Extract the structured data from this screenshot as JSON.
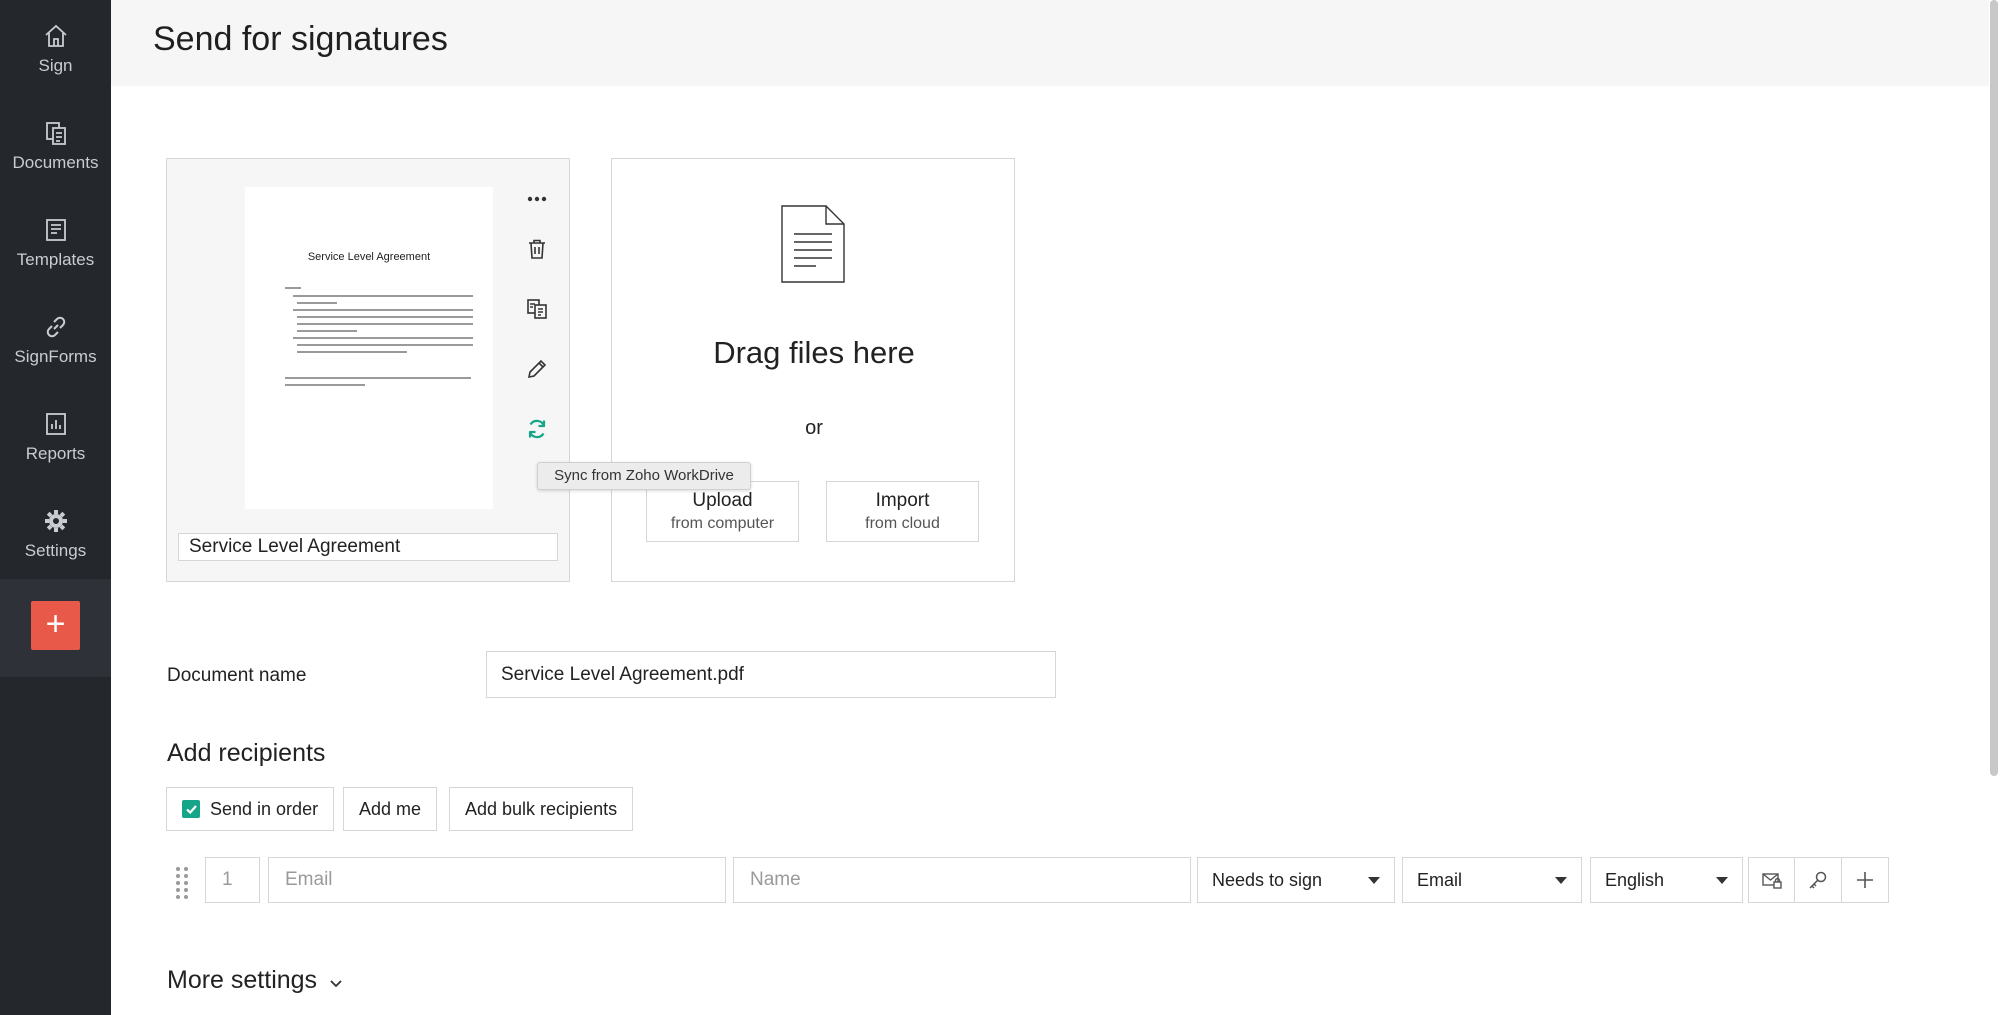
{
  "sidebar": {
    "items": [
      {
        "label": "Sign",
        "icon": "home-icon"
      },
      {
        "label": "Documents",
        "icon": "documents-icon"
      },
      {
        "label": "Templates",
        "icon": "templates-icon"
      },
      {
        "label": "SignForms",
        "icon": "link-icon"
      },
      {
        "label": "Reports",
        "icon": "reports-icon"
      },
      {
        "label": "Settings",
        "icon": "gear-icon"
      }
    ],
    "new_button": "+"
  },
  "header": {
    "title": "Send for signatures"
  },
  "document_card": {
    "preview_title": "Service Level Agreement",
    "name_value": "Service Level Agreement",
    "actions": [
      "more-icon",
      "trash-icon",
      "copy-icon",
      "pencil-icon",
      "sync-icon"
    ]
  },
  "tooltip": {
    "text": "Sync from Zoho WorkDrive"
  },
  "drop_zone": {
    "drag_text": "Drag files here",
    "or_text": "or",
    "upload": {
      "title": "Upload",
      "subtitle": "from computer"
    },
    "import": {
      "title": "Import",
      "subtitle": "from cloud"
    }
  },
  "document_name": {
    "label": "Document name",
    "value": "Service Level Agreement.pdf"
  },
  "recipients": {
    "title": "Add recipients",
    "send_in_order_label": "Send in order",
    "send_in_order_checked": true,
    "add_me_label": "Add me",
    "add_bulk_label": "Add bulk recipients",
    "row": {
      "order": "1",
      "email_placeholder": "Email",
      "name_placeholder": "Name",
      "role": "Needs to sign",
      "delivery": "Email",
      "language": "English"
    }
  },
  "more_settings": {
    "label": "More settings"
  },
  "colors": {
    "sidebar_bg": "#24272c",
    "accent_red": "#e8594a",
    "accent_green": "#17a589"
  }
}
